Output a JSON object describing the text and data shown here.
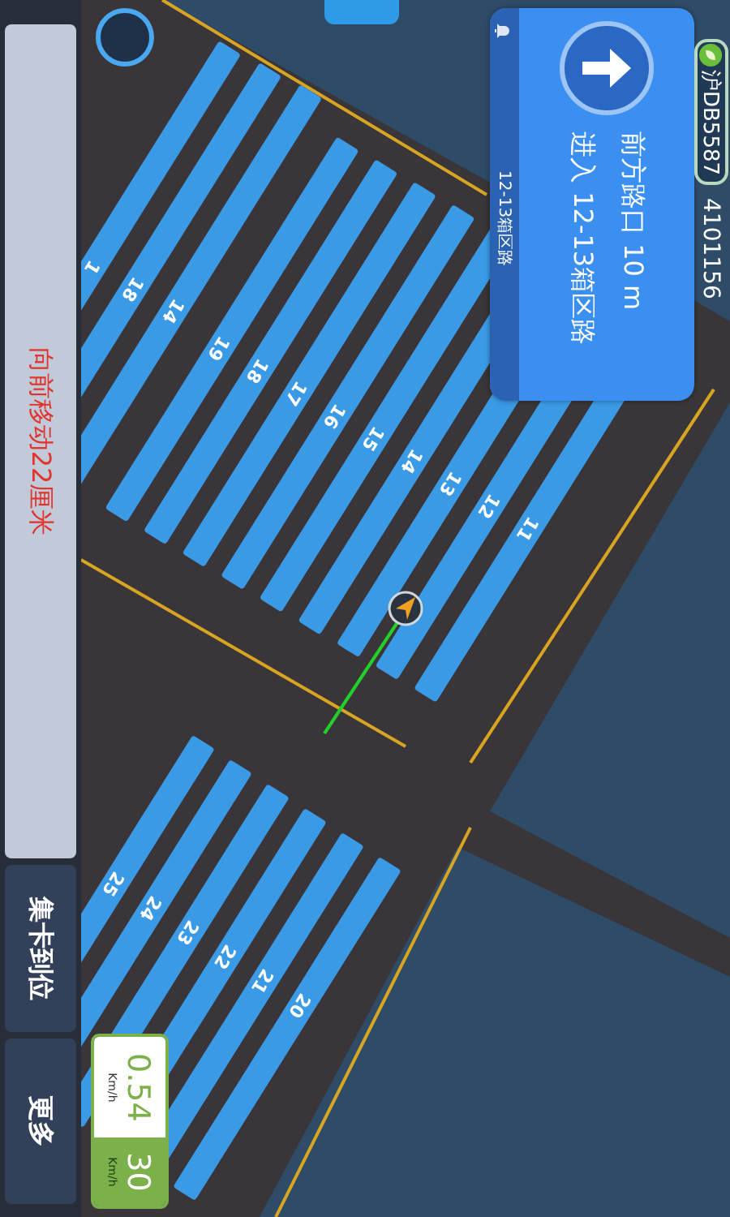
{
  "navigation": {
    "maneuver": {
      "kind": "straight"
    },
    "distance_text": "前方路口 10 m",
    "instruction": "进入 12-13箱区路",
    "current_road": "12-13箱区路"
  },
  "vehicle": {
    "plate": "沪DB5587",
    "id": "4101156"
  },
  "yard": {
    "blocks": [
      {
        "bays": [
          "1",
          "18",
          "14"
        ]
      },
      {
        "bays": [
          "19",
          "18",
          "17",
          "16",
          "15",
          "14",
          "13",
          "12",
          "11"
        ]
      },
      {
        "bays": [
          "25",
          "24",
          "23",
          "22",
          "21",
          "20"
        ]
      }
    ]
  },
  "speed": {
    "current": "0.54",
    "current_unit": "Km/h",
    "limit": "30",
    "limit_unit": "Km/h"
  },
  "prompt": "向前移动22厘米",
  "buttons": [
    {
      "label": "集卡到位"
    },
    {
      "label": "更多"
    }
  ]
}
